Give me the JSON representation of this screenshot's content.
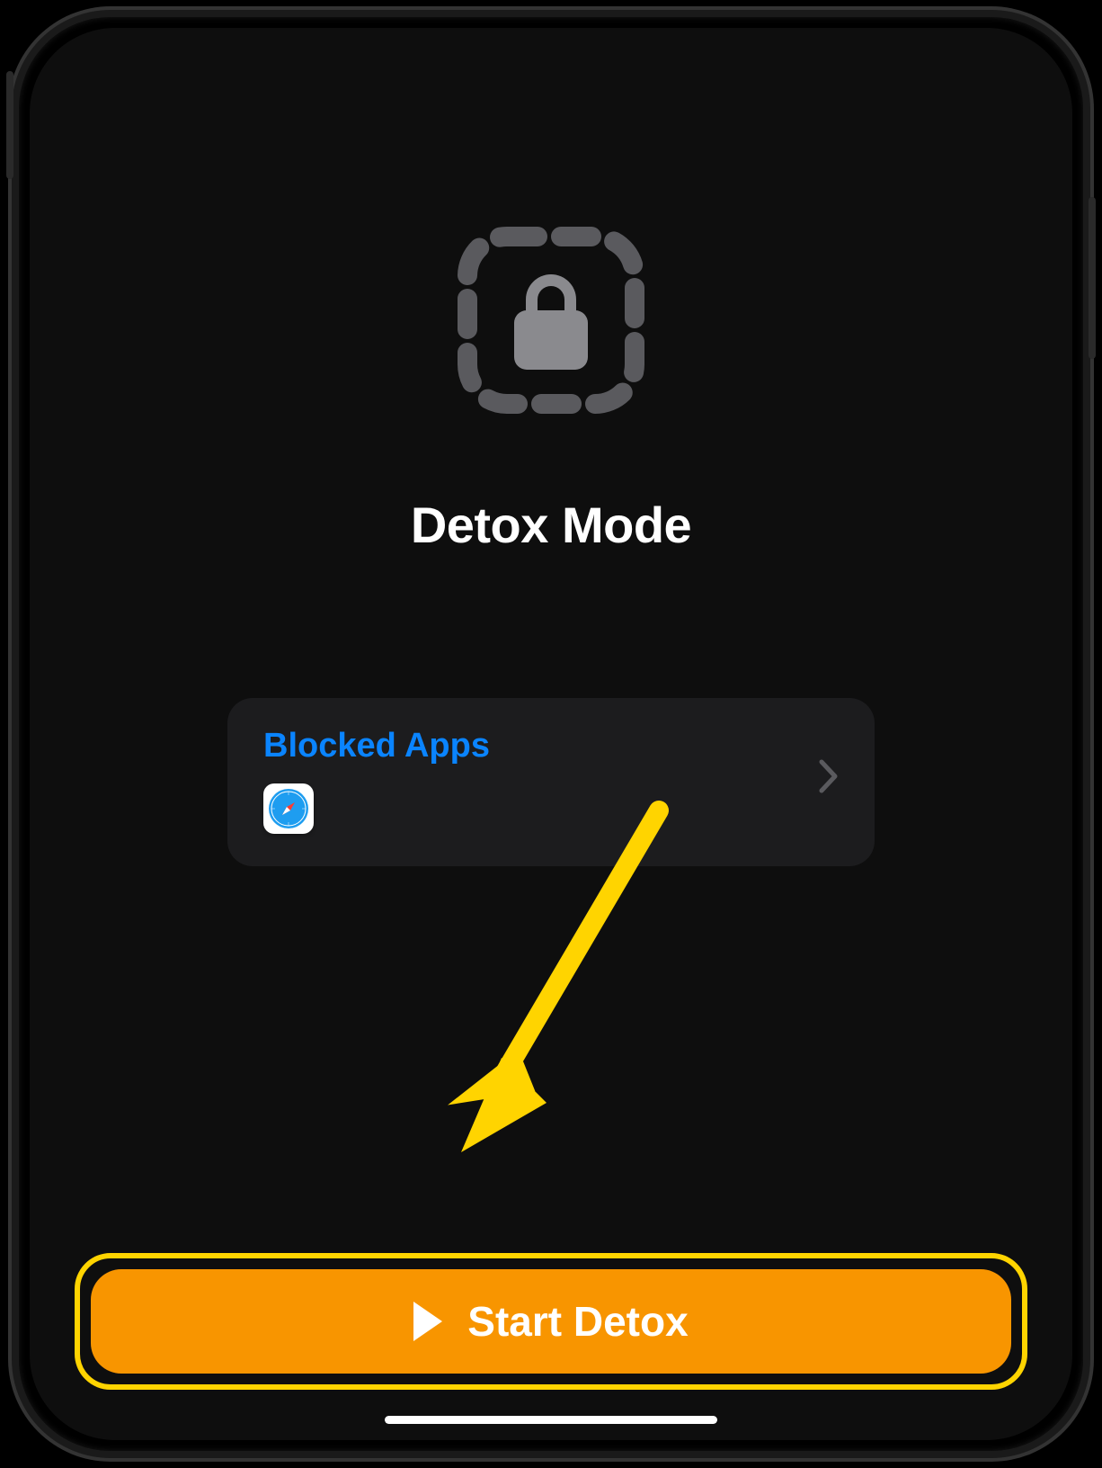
{
  "header": {
    "title": "Detox Mode",
    "icon": "lock-in-dashed-square"
  },
  "blockedApps": {
    "label": "Blocked Apps",
    "apps": [
      {
        "name": "Safari",
        "icon": "safari"
      }
    ]
  },
  "startButton": {
    "label": "Start Detox",
    "icon": "play"
  },
  "colors": {
    "accent": "#f89500",
    "link": "#0a84ff",
    "highlight": "#ffd400"
  },
  "annotation": {
    "type": "arrow",
    "target": "start-detox-button"
  }
}
